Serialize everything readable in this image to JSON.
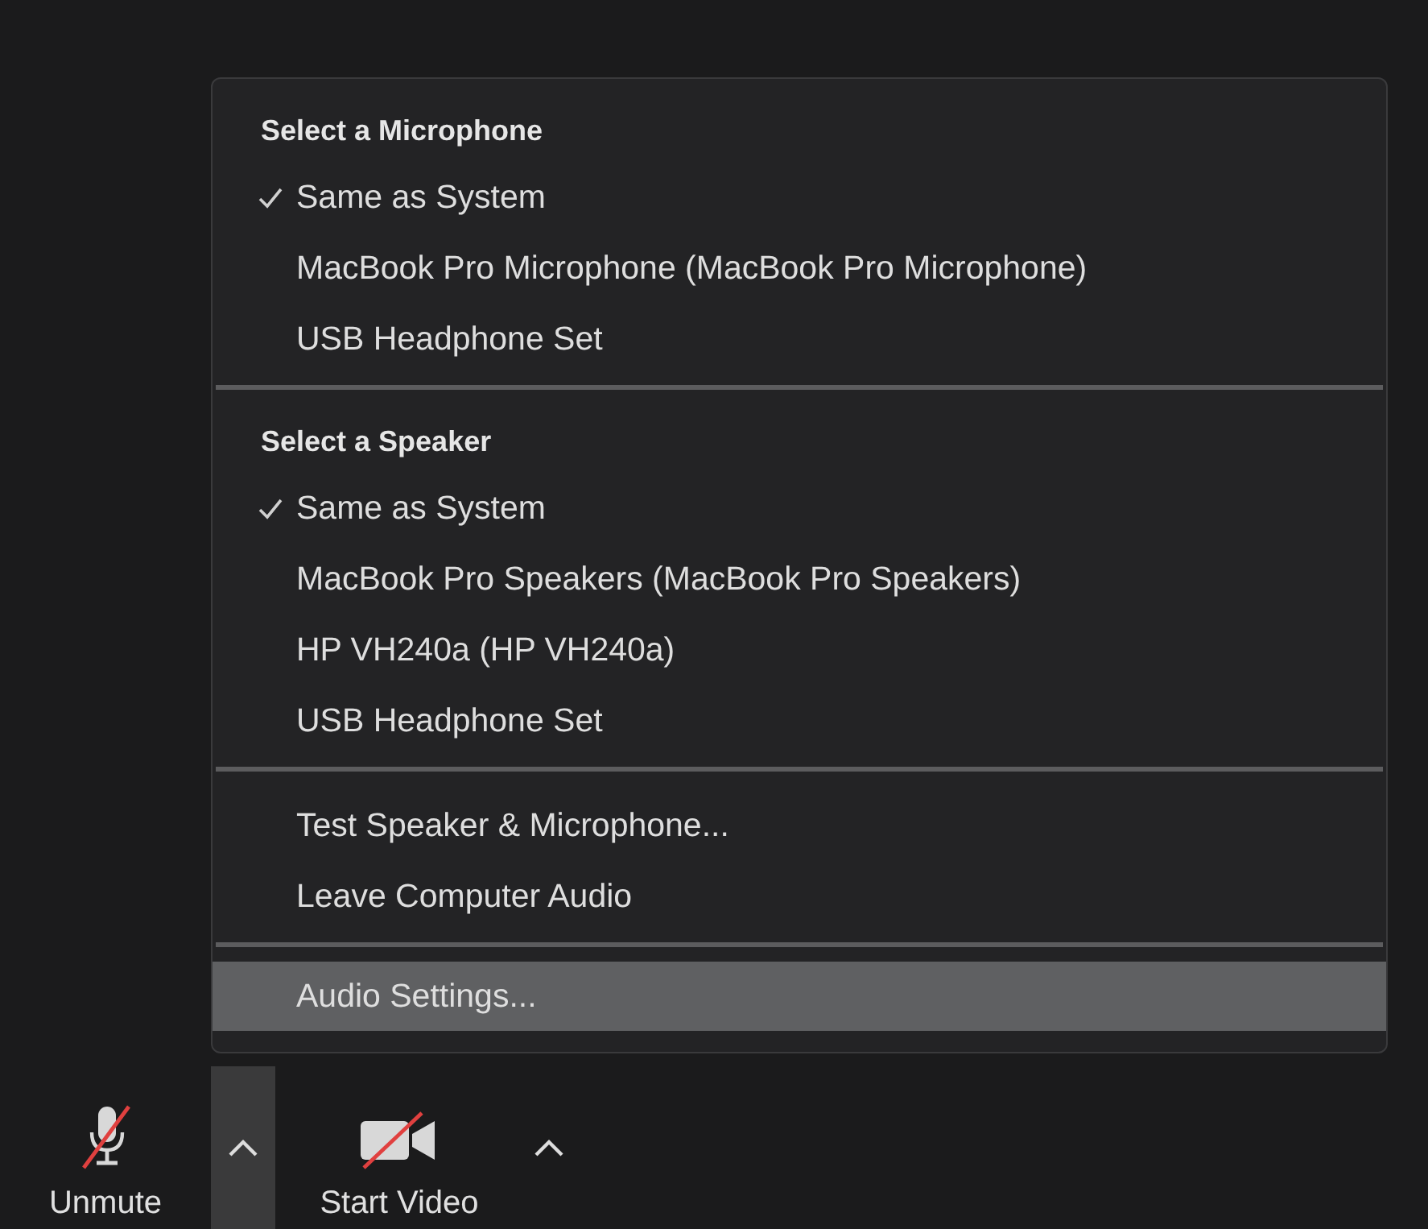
{
  "menu": {
    "sections": [
      {
        "header": "Select a Microphone",
        "items": [
          {
            "label": "Same as System",
            "checked": true,
            "highlighted": false
          },
          {
            "label": "MacBook Pro Microphone (MacBook Pro Microphone)",
            "checked": false,
            "highlighted": false
          },
          {
            "label": "USB Headphone Set",
            "checked": false,
            "highlighted": false
          }
        ]
      },
      {
        "header": "Select a Speaker",
        "items": [
          {
            "label": "Same as System",
            "checked": true,
            "highlighted": false
          },
          {
            "label": "MacBook Pro Speakers (MacBook Pro Speakers)",
            "checked": false,
            "highlighted": false
          },
          {
            "label": "HP VH240a (HP VH240a)",
            "checked": false,
            "highlighted": false
          },
          {
            "label": "USB Headphone Set",
            "checked": false,
            "highlighted": false
          }
        ]
      },
      {
        "items": [
          {
            "label": "Test Speaker & Microphone...",
            "checked": false,
            "highlighted": false
          },
          {
            "label": "Leave Computer Audio",
            "checked": false,
            "highlighted": false
          }
        ]
      },
      {
        "items": [
          {
            "label": "Audio Settings...",
            "checked": false,
            "highlighted": true
          }
        ]
      }
    ]
  },
  "toolbar": [
    {
      "kind": "mic",
      "label": "Unmute",
      "off": true
    },
    {
      "kind": "caret",
      "selected": true
    },
    {
      "kind": "video",
      "label": "Start Video",
      "off": true
    },
    {
      "kind": "caret",
      "selected": false
    }
  ]
}
